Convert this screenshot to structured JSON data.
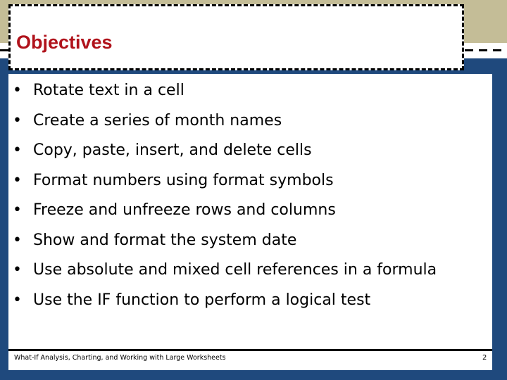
{
  "slide": {
    "title": "Objectives",
    "bullets": [
      "Rotate text in a cell",
      "Create a series of month names",
      "Copy, paste, insert, and delete cells",
      "Format numbers using format symbols",
      "Freeze and unfreeze rows and columns",
      "Show and format the system date",
      "Use absolute and mixed cell references in a formula",
      "Use the IF function to perform a logical test"
    ],
    "bullet_glyph": "•",
    "footer": "What-If Analysis, Charting, and Working with Large Worksheets",
    "page_number": "2"
  },
  "colors": {
    "title": "#b0121b",
    "tan_band": "#c4bd97",
    "navy_band": "#1f497d"
  }
}
